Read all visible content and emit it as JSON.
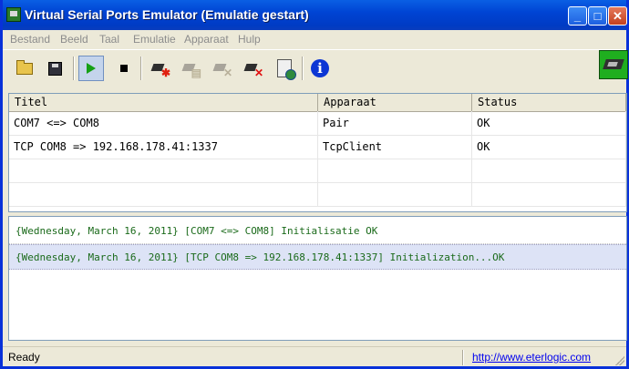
{
  "window": {
    "title": "Virtual Serial Ports Emulator (Emulatie gestart)",
    "controls": {
      "minimize": "_",
      "maximize": "□",
      "close": "✕"
    }
  },
  "menu": [
    {
      "label": "Bestand"
    },
    {
      "label": "Beeld"
    },
    {
      "label": "Taal"
    },
    {
      "label": "Emulatie"
    },
    {
      "label": "Apparaat"
    },
    {
      "label": "Hulp"
    }
  ],
  "toolbar": {
    "tools": [
      {
        "icon": "open-folder-icon"
      },
      {
        "icon": "save-disk-icon"
      },
      {
        "icon": "start-play-icon",
        "active": true
      },
      {
        "icon": "stop-icon"
      },
      {
        "icon": "new-device-icon"
      },
      {
        "icon": "edit-device-icon",
        "disabled": true
      },
      {
        "icon": "remove-device-icon",
        "disabled": true
      },
      {
        "icon": "delete-device-icon"
      },
      {
        "icon": "device-properties-icon"
      },
      {
        "icon": "info-icon",
        "glyph": "i"
      }
    ],
    "logo_icon": "serial-port-logo-icon"
  },
  "table": {
    "columns": [
      "Titel",
      "Apparaat",
      "Status"
    ],
    "rows": [
      [
        "COM7 <=> COM8",
        "Pair",
        "OK"
      ],
      [
        "TCP COM8 => 192.168.178.41:1337",
        "TcpClient",
        "OK"
      ]
    ],
    "empty_rows": 2
  },
  "log": [
    "{Wednesday, March 16, 2011} [COM7 <=> COM8] Initialisatie OK",
    "{Wednesday, March 16, 2011} [TCP COM8 => 192.168.178.41:1337] Initialization...OK"
  ],
  "status": {
    "text": "Ready",
    "link": "http://www.eterlogic.com"
  },
  "colors": {
    "title_bar": "#0044d4",
    "log_text": "#1a6a1a",
    "selected_log_row": "#dde3f6",
    "link": "#0000ee"
  }
}
